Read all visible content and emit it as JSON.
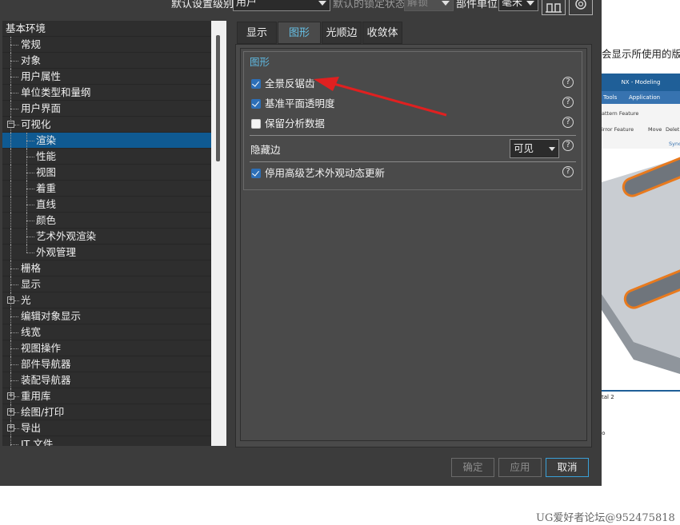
{
  "topbar": {
    "default_level_label": "默认设置级别",
    "default_level_value": "用户",
    "lock_state_label": "默认的锁定状态",
    "lock_state_value": "解锁",
    "part_unit_label": "部件单位",
    "part_unit_value": "毫米"
  },
  "tree": {
    "items": [
      {
        "label": "基本环境"
      },
      {
        "label": "常规"
      },
      {
        "label": "对象"
      },
      {
        "label": "用户属性"
      },
      {
        "label": "单位类型和量纲"
      },
      {
        "label": "用户界面"
      },
      {
        "label": "可视化"
      },
      {
        "label": "渲染"
      },
      {
        "label": "性能"
      },
      {
        "label": "视图"
      },
      {
        "label": "着重"
      },
      {
        "label": "直线"
      },
      {
        "label": "颜色"
      },
      {
        "label": "艺术外观渲染"
      },
      {
        "label": "外观管理"
      },
      {
        "label": "栅格"
      },
      {
        "label": "显示"
      },
      {
        "label": "光"
      },
      {
        "label": "编辑对象显示"
      },
      {
        "label": "线宽"
      },
      {
        "label": "视图操作"
      },
      {
        "label": "部件导航器"
      },
      {
        "label": "装配导航器"
      },
      {
        "label": "重用库"
      },
      {
        "label": "绘图/打印"
      },
      {
        "label": "导出"
      },
      {
        "label": "JT 文件"
      }
    ]
  },
  "tabs": [
    {
      "label": "显示"
    },
    {
      "label": "图形"
    },
    {
      "label": "光顺边"
    },
    {
      "label": "收敛体"
    }
  ],
  "group": {
    "title": "图形",
    "options": [
      {
        "label": "全景反锯齿",
        "checked": true
      },
      {
        "label": "基准平面透明度",
        "checked": true
      },
      {
        "label": "保留分析数据",
        "checked": false
      }
    ],
    "hidden_edges_label": "隐藏边",
    "hidden_edges_value": "可见",
    "disable_label": "停用高级艺术外观动态更新",
    "help_glyph": "?"
  },
  "buttons": {
    "ok": "确定",
    "apply": "应用",
    "cancel": "取消"
  },
  "background": {
    "text": "会显示所使用的版",
    "shot_title": "NX - Modeling",
    "shot_menu_tools": "Tools",
    "shot_menu_application": "Application",
    "shot_tool1": "attern Feature",
    "shot_tool2": "irror Feature",
    "shot_move": "Move",
    "shot_delete": "Delet",
    "shot_sync": "Sync",
    "shot_bottom": "tal 2",
    "period": "。",
    "watermark": "UG爱好者论坛@952475818"
  },
  "colors": {
    "accent": "#66c0e6",
    "selection": "#0f5a92",
    "arrow": "#e02020",
    "orange_part": "#e87a1e"
  }
}
